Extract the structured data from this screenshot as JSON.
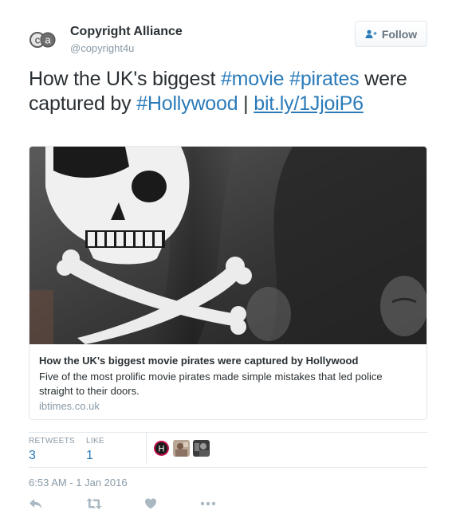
{
  "author": {
    "name": "Copyright Alliance",
    "handle": "@copyright4u",
    "avatar_text": "ca"
  },
  "follow_button": {
    "label": "Follow",
    "icon": "add-user-icon"
  },
  "tweet": {
    "text_parts": {
      "p1": "How the UK's biggest ",
      "h1": "#movie",
      "p2": " ",
      "h2": "#pirates",
      "p3": " were captured by ",
      "h3": "#Hollywood",
      "p4": " | ",
      "link": "bit.ly/1JjoiP6"
    }
  },
  "card": {
    "title": "How the UK's biggest movie pirates were captured by Hollywood",
    "description": "Five of the most prolific movie pirates made simple mistakes that led police straight to their doors.",
    "domain": "ibtimes.co.uk",
    "image": "pirate-flag-image"
  },
  "stats": {
    "retweets_label": "RETWEETS",
    "retweets_count": "3",
    "likes_label": "LIKE",
    "likes_count": "1",
    "liker_avatars": [
      "liker-avatar-h",
      "liker-avatar-2",
      "liker-avatar-3"
    ],
    "liker_initial": "H"
  },
  "timestamp": "6:53 AM - 1 Jan 2016",
  "actions": [
    "reply-icon",
    "retweet-icon",
    "like-icon",
    "more-icon"
  ],
  "colors": {
    "link": "#2b7bb9",
    "text": "#292f33",
    "muted": "#8899a6",
    "border": "#e1e8ed"
  }
}
